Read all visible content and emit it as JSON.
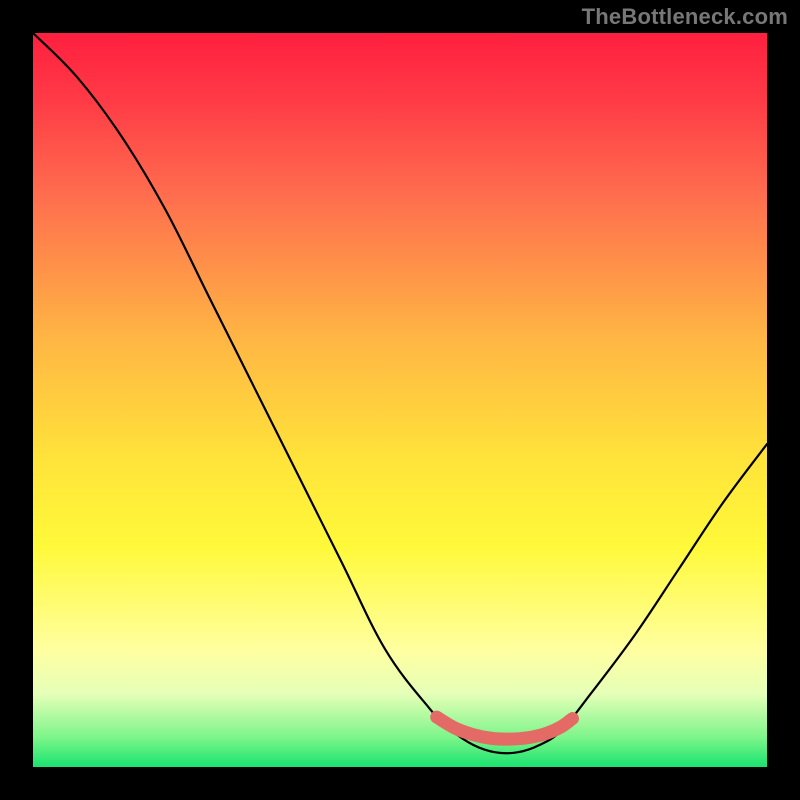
{
  "watermark": "TheBottleneck.com",
  "colors": {
    "frame_bg": "#000000",
    "watermark_text": "#777777",
    "curve": "#000000",
    "overlay": "#e46a66",
    "gradient_stops": [
      "#ff1f3f",
      "#ff3a46",
      "#ff6d4e",
      "#ffb744",
      "#ffe33a",
      "#fff93a",
      "#ffffa0",
      "#e6ffb8",
      "#7cf58a",
      "#19e36f"
    ]
  },
  "chart_data": {
    "type": "line",
    "title": "",
    "xlabel": "",
    "ylabel": "",
    "xlim": [
      0,
      100
    ],
    "ylim": [
      0,
      100
    ],
    "grid": false,
    "series": [
      {
        "name": "bottleneck_curve",
        "x": [
          0,
          6,
          12,
          18,
          24,
          30,
          36,
          42,
          48,
          54,
          57,
          60,
          63,
          66,
          69,
          72,
          76,
          82,
          88,
          94,
          100
        ],
        "values": [
          100,
          94,
          86,
          76,
          64,
          52,
          40,
          28,
          16,
          8,
          5,
          3,
          2,
          2,
          3,
          5,
          10,
          18,
          27,
          36,
          44
        ]
      },
      {
        "name": "optimal_range_overlay",
        "x": [
          55,
          57.5,
          60,
          62.5,
          65,
          67.5,
          70,
          72,
          73.5
        ],
        "values": [
          6.8,
          5.3,
          4.4,
          3.9,
          3.8,
          4.0,
          4.6,
          5.5,
          6.6
        ]
      }
    ],
    "annotations": []
  }
}
